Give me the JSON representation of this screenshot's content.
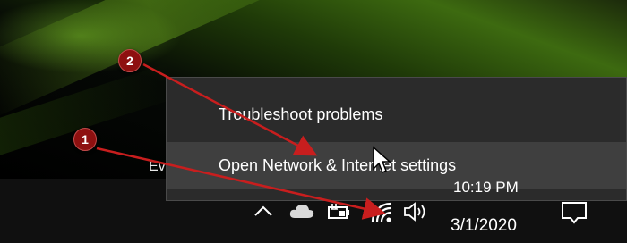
{
  "desktop": {
    "partial_label": "Ev"
  },
  "context_menu": {
    "items": [
      {
        "label": "Troubleshoot problems"
      },
      {
        "label": "Open Network & Internet settings"
      }
    ]
  },
  "tray": {
    "icons": [
      "show-hidden-icons-chevron",
      "onedrive-cloud-icon",
      "battery-charging-icon",
      "wifi-icon",
      "volume-icon",
      "action-center-icon"
    ],
    "clock_time": "10:19 PM",
    "clock_date": "3/1/2020"
  },
  "annotations": {
    "markers": [
      {
        "label": "1"
      },
      {
        "label": "2"
      }
    ],
    "color": "#c81e1e"
  },
  "colors": {
    "menu_background": "#2b2b2b",
    "menu_highlight": "#3f3f3f",
    "taskbar": "#101010",
    "wallpaper_accent": "#4f8a12"
  }
}
